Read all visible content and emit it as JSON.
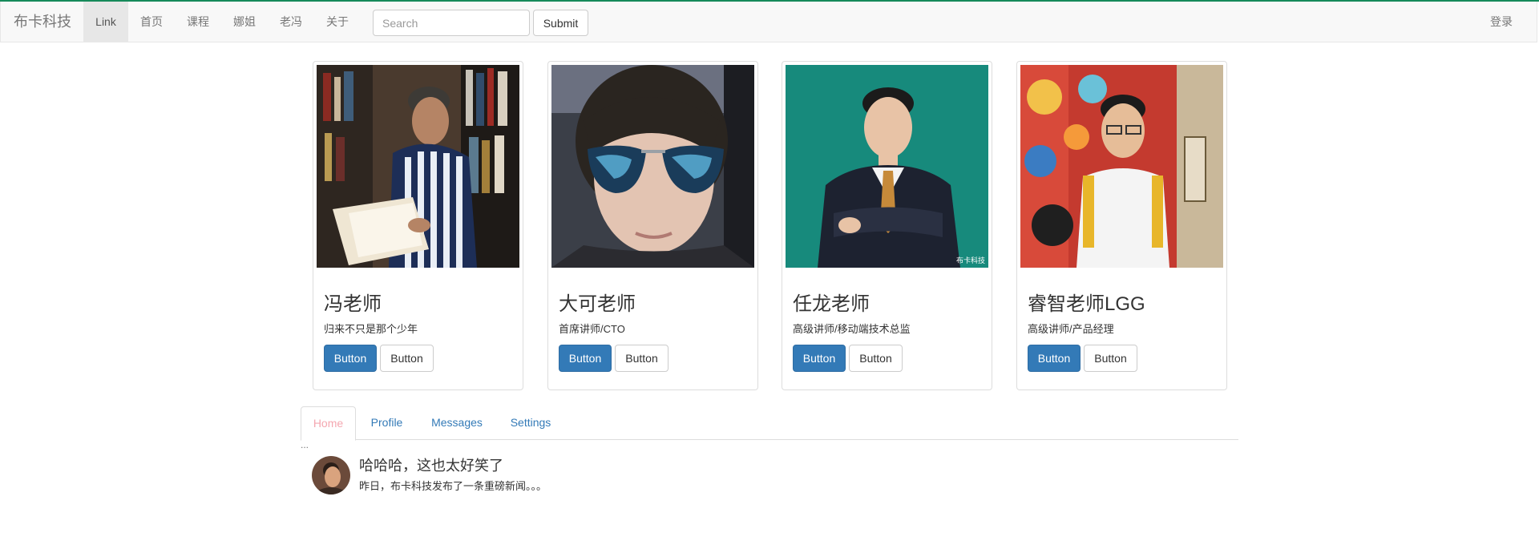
{
  "navbar": {
    "brand": "布卡科技",
    "links": [
      "Link",
      "首页",
      "课程",
      "娜姐",
      "老冯",
      "关于"
    ],
    "search": {
      "placeholder": "Search",
      "value": ""
    },
    "submit_label": "Submit",
    "login_label": "登录"
  },
  "cards": [
    {
      "name": "冯老师",
      "desc": "归来不只是那个少年",
      "primary_label": "Button",
      "default_label": "Button"
    },
    {
      "name": "大可老师",
      "desc": "首席讲师/CTO",
      "primary_label": "Button",
      "default_label": "Button"
    },
    {
      "name": "任龙老师",
      "desc": "高级讲师/移动端技术总监",
      "primary_label": "Button",
      "default_label": "Button",
      "watermark": "布卡科技"
    },
    {
      "name": "睿智老师LGG",
      "desc": "高级讲师/产品经理",
      "primary_label": "Button",
      "default_label": "Button"
    }
  ],
  "tabs": [
    "Home",
    "Profile",
    "Messages",
    "Settings"
  ],
  "tab_content": {
    "ellipsis": "..."
  },
  "media": {
    "title": "哈哈哈，这也太好笑了",
    "text": "昨日，布卡科技发布了一条重磅新闻。。。"
  },
  "colors": {
    "primary": "#337ab7",
    "active_tab": "#f4a7b0",
    "top_accent": "#168a5a"
  }
}
